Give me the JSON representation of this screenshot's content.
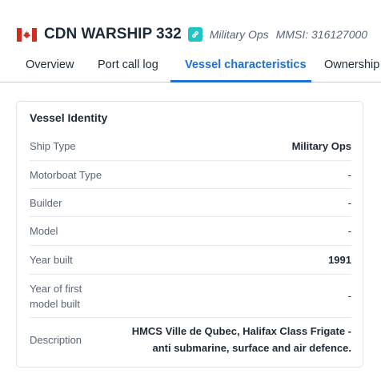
{
  "vessel": {
    "name": "CDN WARSHIP 332",
    "category": "Military Ops",
    "mmsi": "MMSI: 316127000"
  },
  "tabs": [
    {
      "label": "Overview"
    },
    {
      "label": "Port call log"
    },
    {
      "label": "Vessel characteristics"
    },
    {
      "label": "Ownership"
    }
  ],
  "card": {
    "title": "Vessel Identity",
    "rows": [
      {
        "label": "Ship Type",
        "value": "Military Ops"
      },
      {
        "label": "Motorboat Type",
        "value": "-"
      },
      {
        "label": "Builder",
        "value": "-"
      },
      {
        "label": "Model",
        "value": "-"
      },
      {
        "label": "Year built",
        "value": "1991"
      },
      {
        "label": "Year of first model built",
        "value": "-"
      },
      {
        "label": "Description",
        "value": "HMCS Ville de Qubec, Halifax Class Frigate - anti submarine, surface and air defence."
      }
    ]
  },
  "icons": {
    "flag": "canada-flag-icon",
    "link": "link-icon"
  },
  "colors": {
    "accent": "#1f6fd1",
    "link_badge": "#21c4c4",
    "flag_red": "#d52b1e"
  }
}
